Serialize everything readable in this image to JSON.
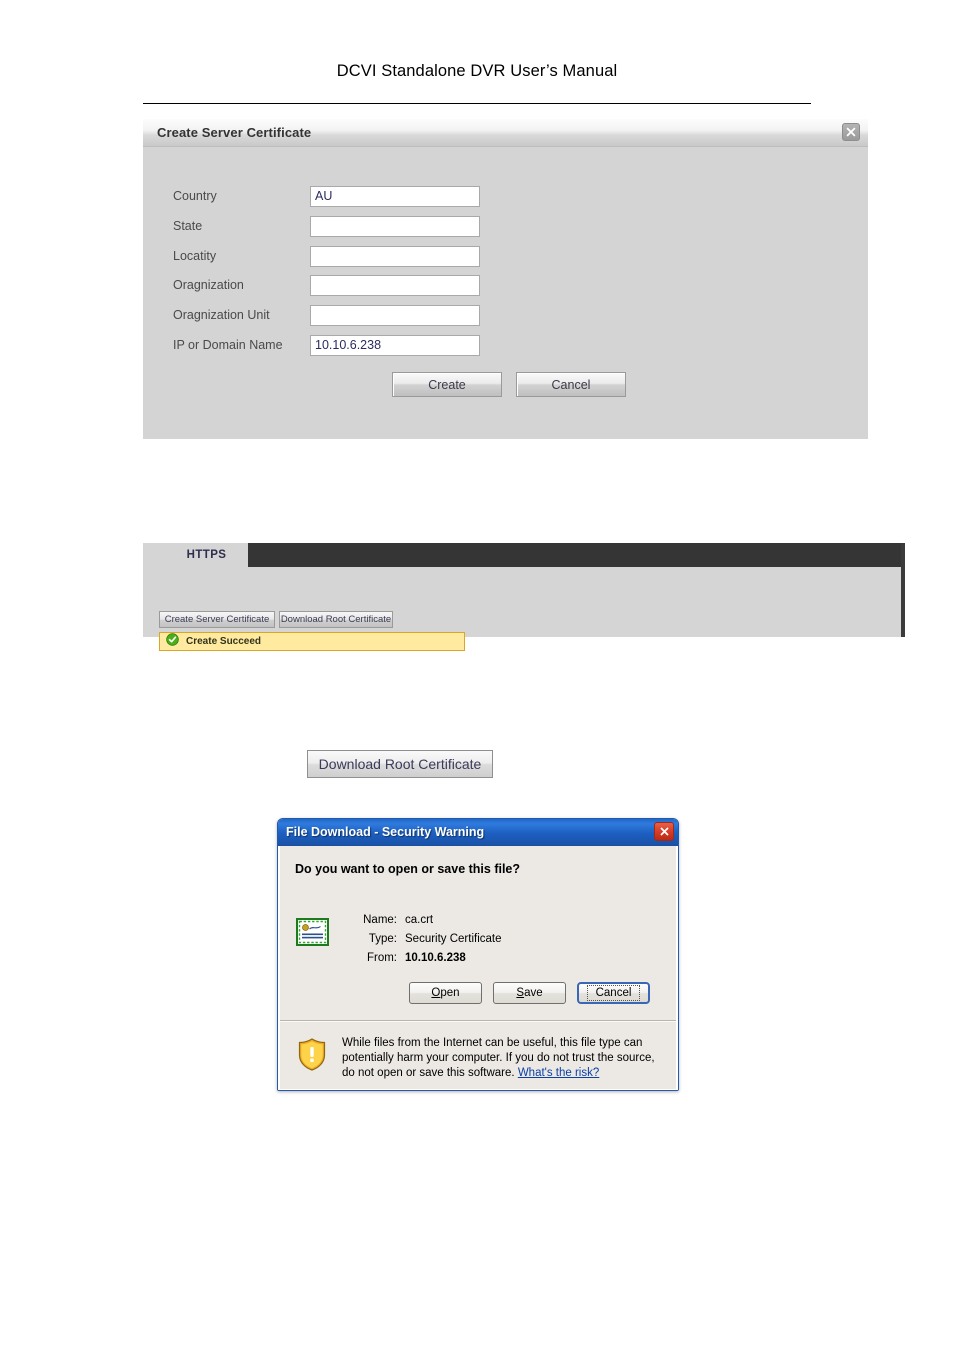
{
  "page": {
    "header_title": "DCVI Standalone DVR User’s Manual"
  },
  "cert_dialog": {
    "title": "Create Server Certificate",
    "close_icon": "close-icon",
    "fields": [
      {
        "label": "Country",
        "value": "AU",
        "placeholder": ""
      },
      {
        "label": "State",
        "value": "",
        "placeholder": ""
      },
      {
        "label": "Locatity",
        "value": "",
        "placeholder": ""
      },
      {
        "label": "Oragnization",
        "value": "",
        "placeholder": ""
      },
      {
        "label": "Oragnization Unit",
        "value": "",
        "placeholder": ""
      },
      {
        "label": "IP or Domain Name",
        "value": "10.10.6.238",
        "placeholder": ""
      }
    ],
    "create_label": "Create",
    "cancel_label": "Cancel"
  },
  "https_panel": {
    "tab_label": "HTTPS",
    "create_server_certificate_label": "Create Server Certificate",
    "download_root_certificate_label": "Download Root Certificate",
    "notice": {
      "icon": "success-check-icon",
      "text": "Create Succeed",
      "background_color": "#ffeaa0",
      "border_color": "#d8a62a",
      "icon_color": "#3fa718"
    }
  },
  "standalone_button": {
    "label": "Download Root Certificate"
  },
  "file_download_dialog": {
    "title": "File Download - Security Warning",
    "close_icon": "close-icon",
    "question": "Do you want to open or save this file?",
    "file_icon": "security-certificate-icon",
    "details": [
      {
        "key": "Name:",
        "value": "ca.crt",
        "bold": false
      },
      {
        "key": "Type:",
        "value": "Security Certificate",
        "bold": false
      },
      {
        "key": "From:",
        "value": "10.10.6.238",
        "bold": true
      }
    ],
    "buttons": {
      "open_label": "Open",
      "open_accel": "O",
      "save_label": "Save",
      "save_accel": "S",
      "cancel_label": "Cancel"
    },
    "warning": {
      "icon": "warning-shield-icon",
      "text": "While files from the Internet can be useful, this file type can potentially harm your computer. If you do not trust the source, do not open or save this software.",
      "link_text": "What's the risk?"
    },
    "titlebar_color": "#1c5fc0",
    "close_color": "#cc3018"
  }
}
